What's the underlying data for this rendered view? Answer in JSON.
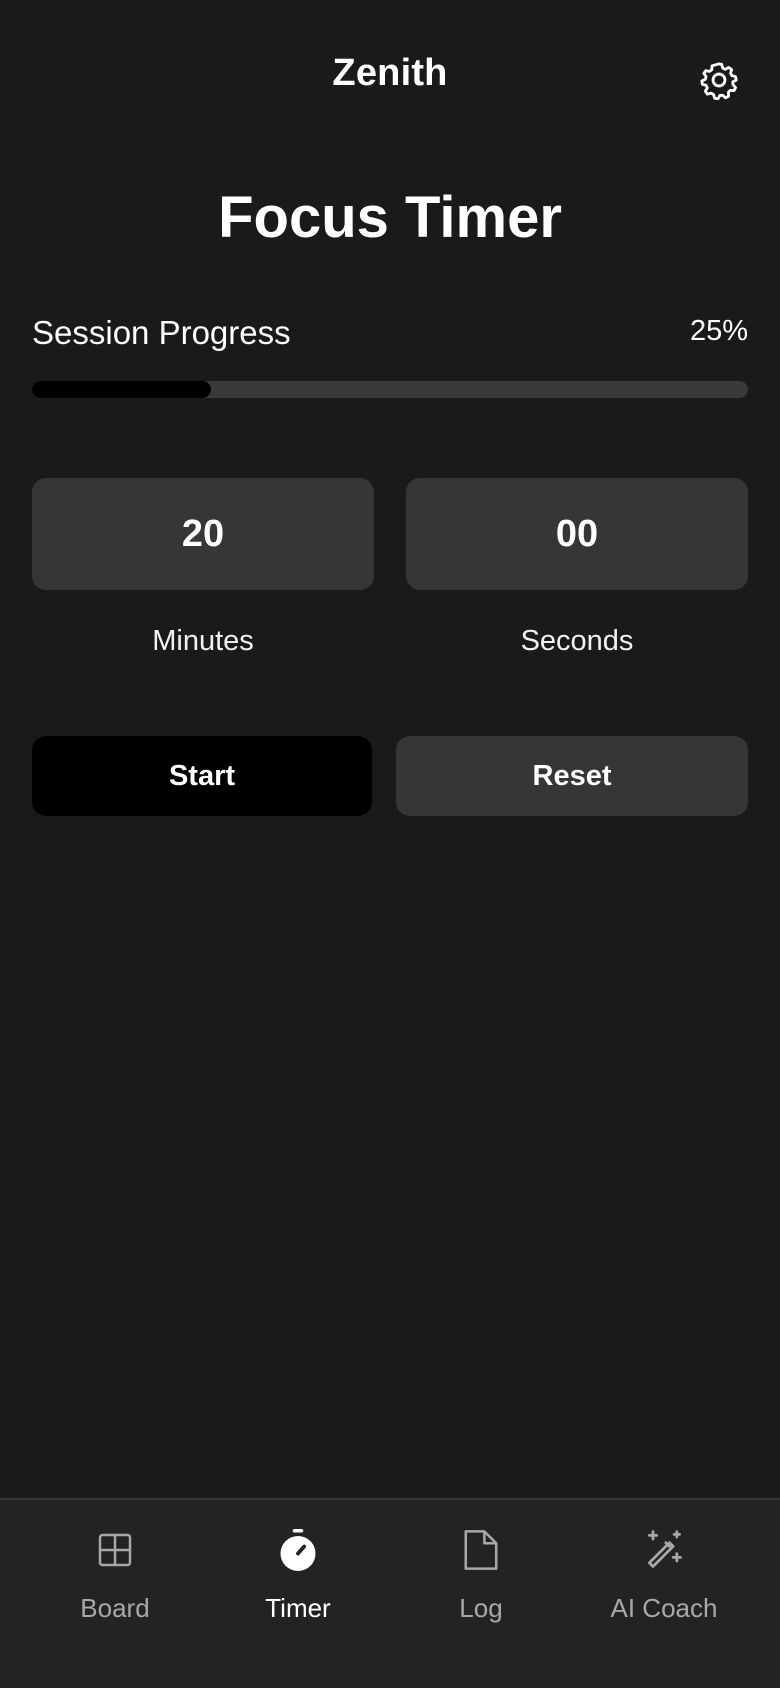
{
  "header": {
    "app_title": "Zenith",
    "settings_icon": "gear-icon"
  },
  "page": {
    "title": "Focus Timer"
  },
  "progress": {
    "label": "Session Progress",
    "value_text": "25%",
    "fraction": 0.25
  },
  "timer": {
    "minutes_value": "20",
    "minutes_label": "Minutes",
    "seconds_value": "00",
    "seconds_label": "Seconds"
  },
  "actions": {
    "start_label": "Start",
    "reset_label": "Reset"
  },
  "nav": {
    "items": [
      {
        "label": "Board",
        "icon": "grid-icon",
        "active": false
      },
      {
        "label": "Timer",
        "icon": "stopwatch-icon",
        "active": true
      },
      {
        "label": "Log",
        "icon": "document-icon",
        "active": false
      },
      {
        "label": "AI Coach",
        "icon": "magic-wand-icon",
        "active": false
      }
    ]
  },
  "colors": {
    "background": "#1a1a1a",
    "surface": "#363636",
    "nav_background": "#232323",
    "primary_button": "#000000",
    "progress_track": "#3a3a3a",
    "progress_fill": "#000000",
    "inactive_text": "#a8a8a8"
  }
}
